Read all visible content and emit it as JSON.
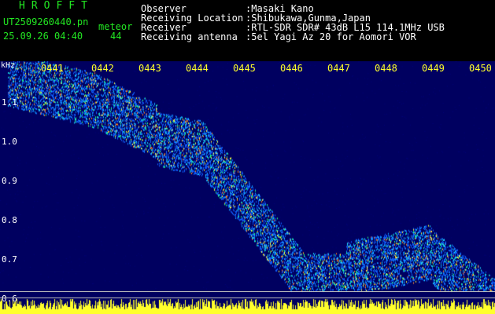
{
  "header": {
    "app_title": "HROFFT",
    "file_name": "UT2509260440.pn",
    "file_suffix": "meteor",
    "datetime": "25.09.26 04:40",
    "count": "44",
    "observer_label": "Observer",
    "observer_value": ":Masaki Kano",
    "location_label": "Receiving Location",
    "location_value": ":Shibukawa,Gunma,Japan",
    "receiver_label": "Receiver",
    "receiver_value": ":RTL-SDR SDR# 43dB L15 114.1MHz USB",
    "antenna_label": "Receiving antenna",
    "antenna_value": ":5el Yagi Az 20 for Aomori VOR"
  },
  "axis": {
    "unit": "kHz",
    "freq_labels": [
      "1.1",
      "1.0",
      "0.9",
      "0.8",
      "0.7",
      "0.6"
    ],
    "time_labels": [
      "0441",
      "0442",
      "0443",
      "0444",
      "0445",
      "0446",
      "0447",
      "0448",
      "0449",
      "0450"
    ]
  },
  "colors": {
    "header_green": "#22e622",
    "time_yellow": "#ffff2a",
    "background": "#000000",
    "spectrogram_bg": "#000060",
    "noise_band": "#ffff2a"
  }
}
